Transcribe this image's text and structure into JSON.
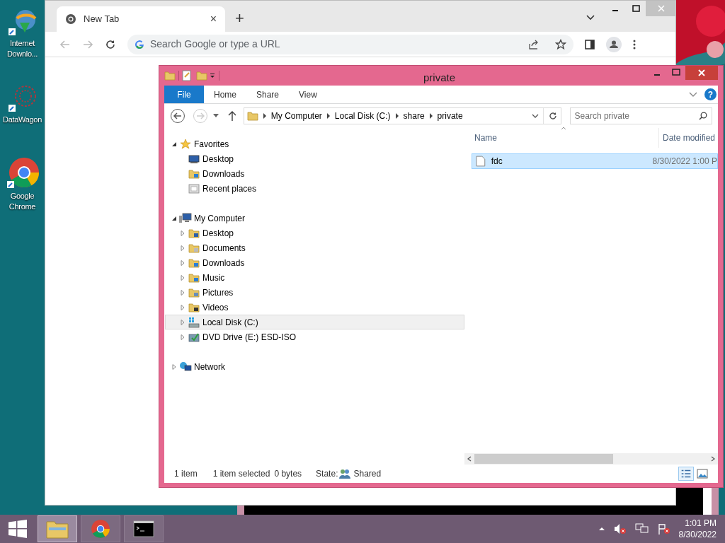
{
  "desktop_icons": [
    {
      "label": "Internet Downlo...",
      "kind": "idm"
    },
    {
      "label": "DataWagon",
      "kind": "wagon"
    },
    {
      "label": "Google Chrome",
      "kind": "chrome"
    }
  ],
  "browser": {
    "tab_title": "New Tab",
    "tab_close": "×",
    "new_tab": "+",
    "address_placeholder": "Search Google or type a URL"
  },
  "explorer": {
    "title": "private",
    "ribbon_tabs": [
      {
        "label": "File",
        "selected": true
      },
      {
        "label": "Home",
        "selected": false
      },
      {
        "label": "Share",
        "selected": false
      },
      {
        "label": "View",
        "selected": false
      }
    ],
    "help": "?",
    "breadcrumb": [
      "My Computer",
      "Local Disk (C:)",
      "share",
      "private"
    ],
    "search_placeholder": "Search private",
    "nav": [
      {
        "label": "Favorites",
        "kind": "star",
        "expanded": true,
        "selected": false,
        "children": [
          {
            "label": "Desktop",
            "kind": "monitor",
            "selected": false
          },
          {
            "label": "Downloads",
            "kind": "downloads",
            "selected": false
          },
          {
            "label": "Recent places",
            "kind": "recent",
            "selected": false
          }
        ]
      },
      {
        "label": "My Computer",
        "kind": "computer",
        "expanded": true,
        "selected": false,
        "children": [
          {
            "label": "Desktop",
            "kind": "desktop-folder",
            "expanded": false,
            "selected": false
          },
          {
            "label": "Documents",
            "kind": "documents",
            "expanded": false,
            "selected": false
          },
          {
            "label": "Downloads",
            "kind": "downloads",
            "expanded": false,
            "selected": false
          },
          {
            "label": "Music",
            "kind": "music",
            "expanded": false,
            "selected": false
          },
          {
            "label": "Pictures",
            "kind": "pictures",
            "expanded": false,
            "selected": false
          },
          {
            "label": "Videos",
            "kind": "videos",
            "expanded": false,
            "selected": false
          },
          {
            "label": "Local Disk (C:)",
            "kind": "drive",
            "expanded": false,
            "selected": true
          },
          {
            "label": "DVD Drive (E:) ESD-ISO",
            "kind": "dvd",
            "expanded": false,
            "selected": false
          }
        ]
      },
      {
        "label": "Network",
        "kind": "network",
        "expanded": false,
        "selected": false
      }
    ],
    "columns": [
      "Name",
      "Date modified"
    ],
    "files": [
      {
        "name": "fdc",
        "date": "8/30/2022 1:00 P",
        "selected": true
      }
    ],
    "status": {
      "count": "1 item",
      "selection": "1 item selected",
      "size": "0 bytes",
      "state_label": "State:",
      "state_value": "Shared"
    }
  },
  "taskbar": {
    "apps": [
      {
        "kind": "explorer",
        "selected": true
      },
      {
        "kind": "chrome",
        "selected": false
      },
      {
        "kind": "console",
        "selected": false
      }
    ],
    "time": "1:01 PM",
    "date": "8/30/2022"
  }
}
